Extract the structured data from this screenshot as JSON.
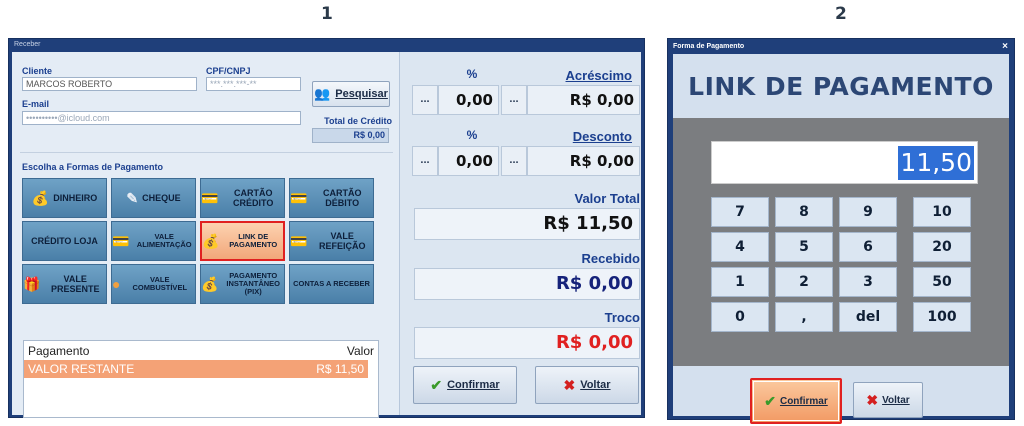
{
  "steps": {
    "one": "1",
    "two": "2"
  },
  "window1": {
    "title": "Receber",
    "client_label": "Cliente",
    "client_value": "MARCOS ROBERTO",
    "cpf_label": "CPF/CNPJ",
    "cpf_value": "***.***.***-**",
    "search_button": "Pesquisar",
    "email_label": "E-mail",
    "email_value": "••••••••••@icloud.com",
    "credit_label": "Total de Crédito",
    "credit_value": "R$ 0,00",
    "choose_label": "Escolha a Formas de Pagamento",
    "payment_methods": {
      "dinheiro": "DINHEIRO",
      "cheque": "CHEQUE",
      "cartao_credito": "CARTÃO CRÉDITO",
      "cartao_debito": "CARTÃO DÉBITO",
      "credito_loja": "CRÉDITO LOJA",
      "vale_alimentacao": "VALE ALIMENTAÇÃO",
      "link_pagamento": "LINK DE PAGAMENTO",
      "vale_refeicao": "VALE REFEIÇÃO",
      "vale_presente": "VALE PRESENTE",
      "vale_combustivel": "VALE COMBUSTÍVEL",
      "pix": "PAGAMENTO INSTANTÂNEO (PIX)",
      "contas_receber": "CONTAS A RECEBER"
    },
    "payments_table": {
      "col_payment": "Pagamento",
      "col_value": "Valor",
      "rows": [
        {
          "payment": "VALOR RESTANTE",
          "value": "R$ 11,50"
        }
      ]
    },
    "surcharge": {
      "pct_label": "%",
      "dots": "...",
      "pct_value": "0,00",
      "label": "Acréscimo",
      "value": "R$ 0,00"
    },
    "discount": {
      "pct_label": "%",
      "dots": "...",
      "pct_value": "0,00",
      "label": "Desconto",
      "value": "R$ 0,00"
    },
    "total_label": "Valor Total",
    "total_value": "R$ 11,50",
    "received_label": "Recebido",
    "received_value": "R$ 0,00",
    "change_label": "Troco",
    "change_value": "R$ 0,00",
    "confirm_button": "Confirmar",
    "back_button": "Voltar",
    "colors": {
      "selected_border": "#e02020",
      "change_red": "#e02020",
      "received_blue": "#15227a"
    }
  },
  "window2": {
    "title": "Forma de Pagamento",
    "close": "×",
    "heading": "LINK DE PAGAMENTO",
    "amount": "11,50",
    "keys": [
      "7",
      "8",
      "9",
      "10",
      "4",
      "5",
      "6",
      "20",
      "1",
      "2",
      "3",
      "50",
      "0",
      ",",
      "del",
      "100"
    ],
    "confirm_button": "Confirmar",
    "back_button": "Voltar"
  }
}
